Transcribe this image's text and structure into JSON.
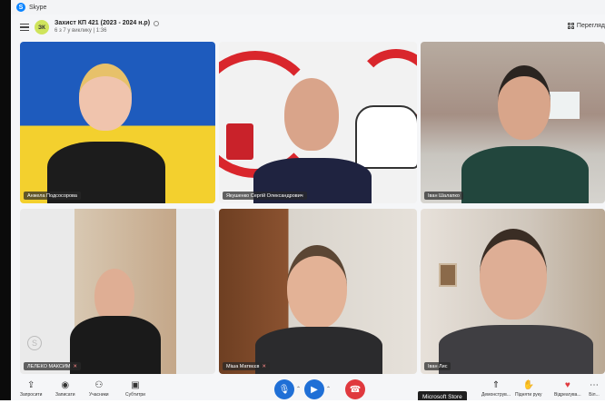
{
  "app": {
    "name": "Skype",
    "icon": "skype-logo-icon"
  },
  "header": {
    "avatar_initials": "ЗК",
    "title": "Захист КП 421 (2023 - 2024 н.р)",
    "subtitle": "6 з 7 у виклику | 1:36",
    "view_button": "Перегляд"
  },
  "participants": [
    {
      "name": "Анжела Подсосорова",
      "muted": false
    },
    {
      "name": "Якушенко Сергій Олександрович",
      "muted": false
    },
    {
      "name": "Іван Шалапко",
      "muted": false
    },
    {
      "name": "ЛЕЛЕКО МАКСИМ",
      "muted": true
    },
    {
      "name": "Міша Матвєєв",
      "muted": true
    },
    {
      "name": "Іван Лис",
      "muted": false
    }
  ],
  "toolbar": {
    "invite": "Запросити",
    "record": "Записати",
    "participants": "Учасники",
    "subtitles": "Субтитри",
    "share": "Демонструв...",
    "raise_hand": "Підняти руку",
    "react": "Відреагува...",
    "more": "Біл..."
  },
  "tooltip": "Microsoft Store",
  "colors": {
    "accent": "#0a84ff",
    "hangup": "#e0393e",
    "call_blue": "#1f6fd6"
  }
}
